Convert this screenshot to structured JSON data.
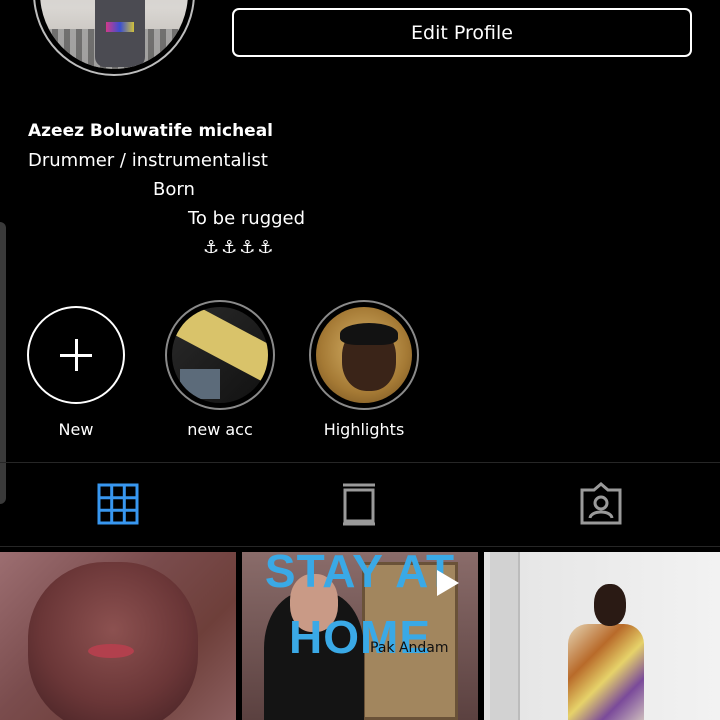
{
  "profile": {
    "edit_label": "Edit Profile",
    "name": "Azeez Boluwatife micheal",
    "bio_lines": [
      "Drummer / instrumentalist",
      "Born",
      "To be rugged",
      "⚓⚓⚓⚓"
    ]
  },
  "highlights": [
    {
      "label": "New"
    },
    {
      "label": "new acc"
    },
    {
      "label": "Highlights"
    }
  ],
  "tabs": [
    {
      "icon": "grid-icon",
      "active": true,
      "color": "#3897f0"
    },
    {
      "icon": "igtv-icon",
      "active": false
    },
    {
      "icon": "tagged-icon",
      "active": false
    }
  ],
  "posts": [
    {
      "kind": "photo"
    },
    {
      "kind": "video",
      "text_top": "STAY AT",
      "text_bottom": "HOME",
      "caption": "Pak Andam"
    },
    {
      "kind": "photo"
    }
  ]
}
